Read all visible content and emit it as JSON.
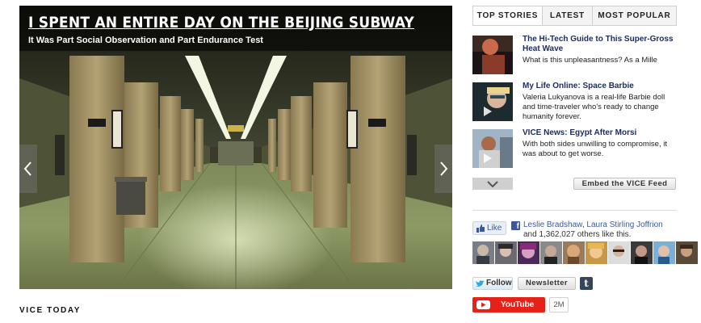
{
  "hero": {
    "title": "I Spent an Entire Day on the Beijing Subway",
    "subtitle": "It Was Part Social Observation and Part Endurance Test",
    "prev_icon": "chevron-left-icon",
    "next_icon": "chevron-right-icon"
  },
  "section_label": "VICE TODAY",
  "tabs": [
    "TOP STORIES",
    "LATEST",
    "MOST POPULAR"
  ],
  "stories": [
    {
      "title": "The Hi-Tech Guide to This Super-Gross Heat Wave",
      "desc": "What is this unpleasantness? As a Mille"
    },
    {
      "title": "My Life Online: Space Barbie",
      "desc": "Valeria Lukyanova is a real-life Barbie doll and time-traveler who's ready to change humanity forever."
    },
    {
      "title": "VICE News: Egypt After Morsi",
      "desc": "With both sides unwilling to compromise, it was about to get worse."
    }
  ],
  "more_icon": "chevron-down-icon",
  "embed_label": "Embed the VICE Feed",
  "facebook": {
    "like_label": "Like",
    "name1": "Leslie Bradshaw",
    "sep": ", ",
    "name2": "Laura Stirling Joffrion",
    "rest": " and 1,362,027 others like this.",
    "logo": "f"
  },
  "twitter": {
    "label": "Follow"
  },
  "newsletter": {
    "label": "Newsletter"
  },
  "tumblr": {
    "glyph": "t"
  },
  "youtube": {
    "label": "YouTube",
    "count": "2M"
  },
  "colors": {
    "link_blue": "#1d2b5b",
    "facebook_blue": "#3b5998",
    "youtube_red": "#e62117"
  }
}
